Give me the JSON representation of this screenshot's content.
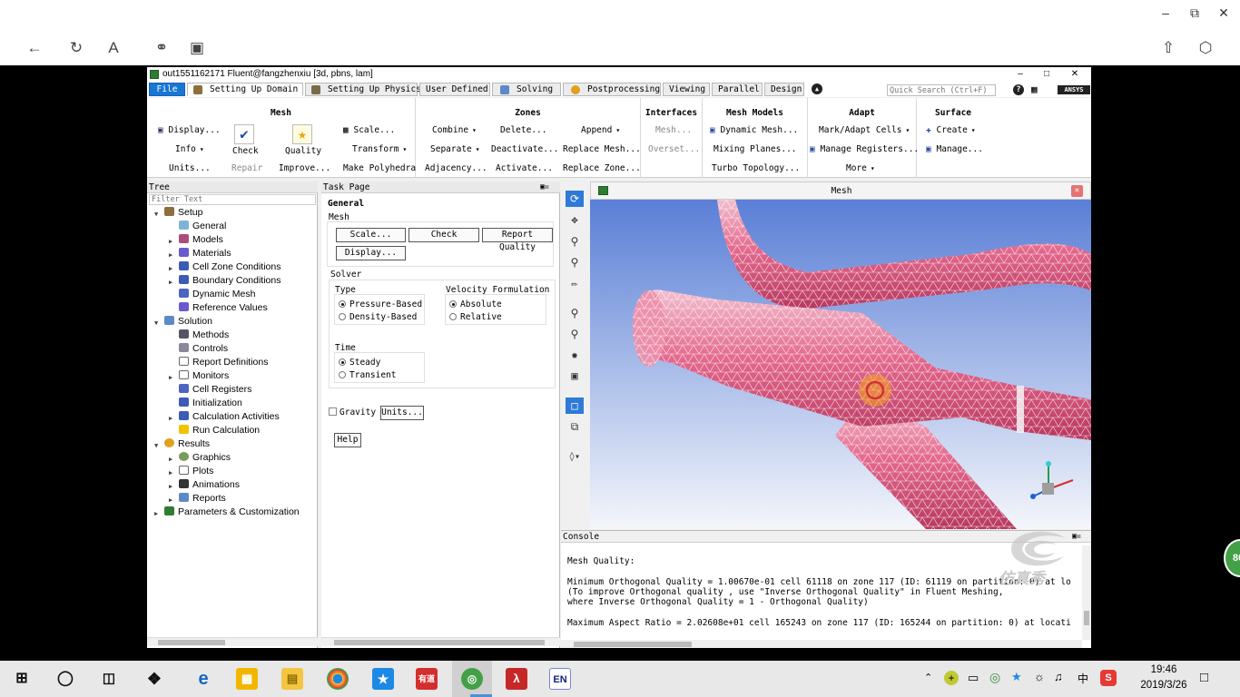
{
  "window": {
    "title": "out1551162171 Fluent@fangzhenxiu  [3d, pbns, lam]",
    "min": "–",
    "max": "□",
    "close": "✕"
  },
  "tabs": [
    {
      "label": "File"
    },
    {
      "label": "Setting Up Domain"
    },
    {
      "label": "Setting Up Physics"
    },
    {
      "label": "User Defined"
    },
    {
      "label": "Solving"
    },
    {
      "label": "Postprocessing"
    },
    {
      "label": "Viewing"
    },
    {
      "label": "Parallel"
    },
    {
      "label": "Design"
    }
  ],
  "quick_search": {
    "placeholder": "Quick Search (Ctrl+F)"
  },
  "brand": "ANSYS",
  "ribbon": {
    "mesh": {
      "title": "Mesh",
      "display": "Display...",
      "info": "Info",
      "units": "Units...",
      "check": "Check",
      "repair": "Repair",
      "quality": "Quality",
      "improve": "Improve...",
      "scale": "Scale...",
      "transform": "Transform",
      "make_polyhedra": "Make Polyhedra"
    },
    "zones": {
      "title": "Zones",
      "combine": "Combine",
      "separate": "Separate",
      "adjacency": "Adjacency...",
      "delete": "Delete...",
      "deactivate": "Deactivate...",
      "activate": "Activate...",
      "append": "Append",
      "replace_mesh": "Replace Mesh...",
      "replace_zone": "Replace Zone..."
    },
    "interfaces": {
      "title": "Interfaces",
      "mesh": "Mesh...",
      "overset": "Overset..."
    },
    "mesh_models": {
      "title": "Mesh Models",
      "dynamic_mesh": "Dynamic Mesh...",
      "mixing_planes": "Mixing Planes...",
      "turbo_topology": "Turbo Topology..."
    },
    "adapt": {
      "title": "Adapt",
      "mark_adapt": "Mark/Adapt Cells",
      "manage_registers": "Manage Registers...",
      "more": "More"
    },
    "surface": {
      "title": "Surface",
      "create": "Create",
      "manage": "Manage..."
    }
  },
  "tree": {
    "header": "Tree",
    "filter_placeholder": "Filter Text",
    "nodes": [
      {
        "label": "Setup"
      },
      {
        "label": "General"
      },
      {
        "label": "Models"
      },
      {
        "label": "Materials"
      },
      {
        "label": "Cell Zone Conditions"
      },
      {
        "label": "Boundary Conditions"
      },
      {
        "label": "Dynamic Mesh"
      },
      {
        "label": "Reference Values"
      },
      {
        "label": "Solution"
      },
      {
        "label": "Methods"
      },
      {
        "label": "Controls"
      },
      {
        "label": "Report Definitions"
      },
      {
        "label": "Monitors"
      },
      {
        "label": "Cell Registers"
      },
      {
        "label": "Initialization"
      },
      {
        "label": "Calculation Activities"
      },
      {
        "label": "Run Calculation"
      },
      {
        "label": "Results"
      },
      {
        "label": "Graphics"
      },
      {
        "label": "Plots"
      },
      {
        "label": "Animations"
      },
      {
        "label": "Reports"
      },
      {
        "label": "Parameters & Customization"
      }
    ]
  },
  "task_page": {
    "header": "Task Page",
    "title": "General",
    "mesh_label": "Mesh",
    "scale_btn": "Scale...",
    "check_btn": "Check",
    "report_quality_btn": "Report Quality",
    "display_btn": "Display...",
    "solver_label": "Solver",
    "type_label": "Type",
    "pressure_based": "Pressure-Based",
    "density_based": "Density-Based",
    "velocity_label": "Velocity Formulation",
    "absolute": "Absolute",
    "relative": "Relative",
    "time_label": "Time",
    "steady": "Steady",
    "transient": "Transient",
    "gravity": "Gravity",
    "units_btn": "Units...",
    "help_btn": "Help"
  },
  "graphics": {
    "title": "Mesh"
  },
  "console": {
    "header": "Console",
    "lines": [
      "Mesh Quality:",
      "",
      "Minimum Orthogonal Quality =  1.00670e-01 cell 61118 on zone 117 (ID: 61119 on partition: 0) at lo",
      "(To improve Orthogonal quality , use \"Inverse Orthogonal Quality\" in Fluent Meshing,",
      " where Inverse Orthogonal Quality = 1 - Orthogonal Quality)",
      "",
      "Maximum Aspect Ratio =  2.02608e+01 cell 165243 on zone 117 (ID: 165244 on partition: 0) at locati"
    ]
  },
  "watermark": "仿真秀",
  "badge": "80",
  "taskbar": {
    "time": "19:46",
    "date": "2019/3/26",
    "ime": "中",
    "apps": [
      "有道",
      "EN"
    ]
  }
}
